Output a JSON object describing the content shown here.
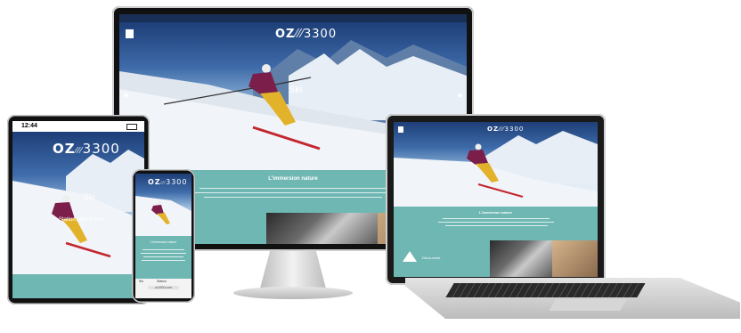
{
  "brand": {
    "name": "OZ",
    "slash": "⁄⁄⁄",
    "altitude": "3300"
  },
  "hero": {
    "title": "Ski"
  },
  "section": {
    "title": "L'immersion nature"
  },
  "tablet": {
    "time": "12:44",
    "hero_subtitle": "Station Alpe d'Huez"
  },
  "phone": {
    "url": "oz3300.com",
    "tab_1": "Ski",
    "tab_2": "Station"
  },
  "laptop": {
    "card_title": "Découverte"
  },
  "colors": {
    "teal": "#6fb7b3",
    "sky": "#3d6aa8",
    "skier_jacket": "#7b1e4a",
    "skier_pants": "#e3b22b"
  }
}
